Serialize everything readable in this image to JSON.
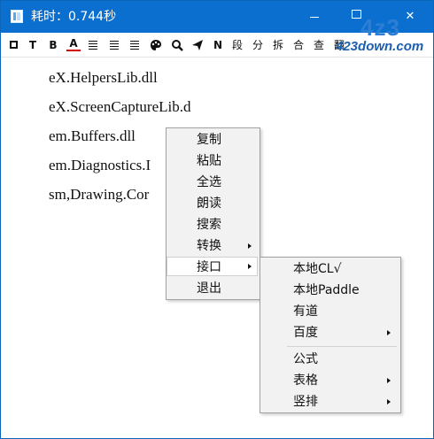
{
  "window": {
    "title": "耗时：0.744秒",
    "icon": "app-icon",
    "controls": [
      "minimize-icon",
      "maximize-icon",
      "close-icon"
    ]
  },
  "watermark": {
    "big": "4z3",
    "small": "423down.com"
  },
  "toolbar": {
    "buttons": [
      {
        "name": "frame-icon",
        "glyph": ""
      },
      {
        "name": "text-icon",
        "glyph": "T"
      },
      {
        "name": "bold-icon",
        "glyph": "B"
      },
      {
        "name": "font-color-icon",
        "glyph": "A"
      },
      {
        "name": "align-left-icon",
        "glyph": ""
      },
      {
        "name": "align-justify-icon",
        "glyph": ""
      },
      {
        "name": "align-right-icon",
        "glyph": ""
      },
      {
        "name": "palette-icon",
        "glyph": "🎨"
      },
      {
        "name": "search-icon",
        "glyph": "🔍"
      },
      {
        "name": "send-icon",
        "glyph": "➤"
      },
      {
        "name": "n-icon",
        "glyph": "N"
      },
      {
        "name": "paragraph-button",
        "glyph": "段"
      },
      {
        "name": "split-button",
        "glyph": "分"
      },
      {
        "name": "break-button",
        "glyph": "拆"
      },
      {
        "name": "merge-button",
        "glyph": "合"
      },
      {
        "name": "lookup-button",
        "glyph": "查"
      },
      {
        "name": "translate-button",
        "glyph": "翻"
      }
    ]
  },
  "content": {
    "lines": [
      "eX.HelpersLib.dll",
      "eX.ScreenCaptureLib.d",
      "em.Buffers.dll",
      "em.Diagnostics.I",
      "sm,Drawing.Cor"
    ]
  },
  "context_menu": {
    "items": [
      {
        "label": "复制",
        "submenu": false
      },
      {
        "label": "粘贴",
        "submenu": false
      },
      {
        "label": "全选",
        "submenu": false
      },
      {
        "label": "朗读",
        "submenu": false
      },
      {
        "label": "搜索",
        "submenu": false
      },
      {
        "label": "转换",
        "submenu": true
      },
      {
        "label": "接口",
        "submenu": true,
        "active": true
      },
      {
        "label": "退出",
        "submenu": false
      }
    ]
  },
  "submenu": {
    "items": [
      {
        "label": "本地CL√",
        "submenu": false
      },
      {
        "label": "本地Paddle",
        "submenu": false
      },
      {
        "label": "有道",
        "submenu": false
      },
      {
        "label": "百度",
        "submenu": true
      },
      {
        "label": "公式",
        "submenu": false
      },
      {
        "label": "表格",
        "submenu": true
      },
      {
        "label": "竖排",
        "submenu": true
      }
    ]
  },
  "colors": {
    "titlebar": "#0a6fce",
    "menu_bg": "#f2f2f2",
    "menu_border": "#a0a0a0",
    "watermark": "#2d7fd6"
  }
}
